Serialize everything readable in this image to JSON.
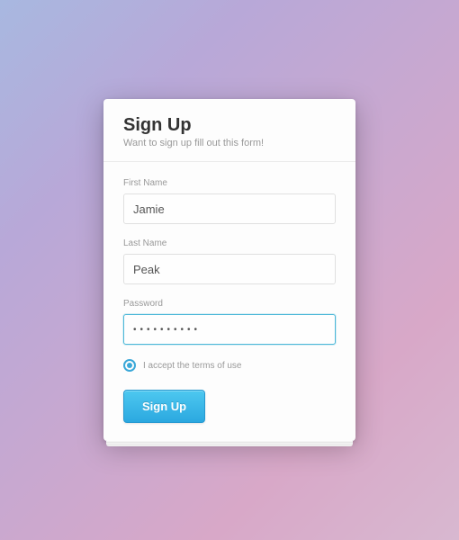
{
  "header": {
    "title": "Sign Up",
    "subtitle": "Want to sign up fill out this form!"
  },
  "fields": {
    "firstName": {
      "label": "First Name",
      "value": "Jamie"
    },
    "lastName": {
      "label": "Last Name",
      "value": "Peak"
    },
    "password": {
      "label": "Password",
      "value": "••••••••••"
    }
  },
  "terms": {
    "label": "I accept the terms of use",
    "checked": true
  },
  "submit": {
    "label": "Sign Up"
  }
}
